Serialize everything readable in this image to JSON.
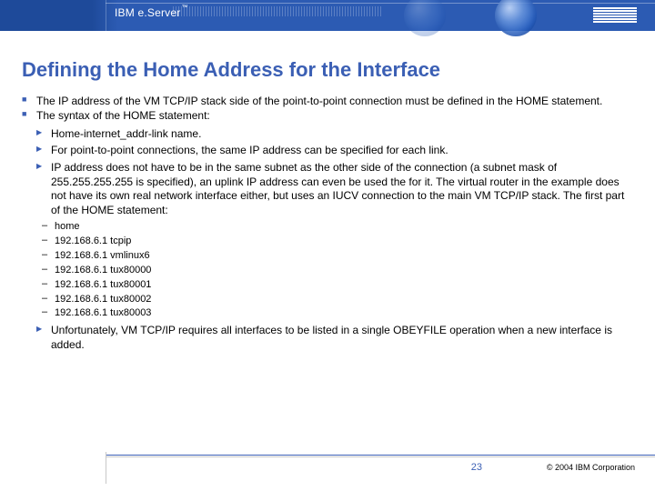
{
  "header": {
    "brand_pre": "IBM e.Server",
    "brand_tm": "™"
  },
  "title": "Defining the Home Address for the Interface",
  "bullets_sq": [
    "The IP address of the VM TCP/IP stack side of the point-to-point connection must be defined in the HOME statement.",
    "The syntax of the HOME statement:"
  ],
  "bullets_tri": [
    "Home-internet_addr-link name.",
    "For point-to-point connections, the same IP address can be specified for each link.",
    "IP address does not have to be in the same subnet as the other side of the connection (a subnet mask of 255.255.255.255 is specified), an uplink IP address can even be used the for it. The virtual router in the example does not have its own real network interface either, but uses an IUCV connection to the main VM TCP/IP stack. The first part of the HOME statement:"
  ],
  "bullets_dash": [
    "home",
    "192.168.6.1 tcpip",
    "192.168.6.1 vmlinux6",
    "192.168.6.1 tux80000",
    "192.168.6.1 tux80001",
    "192.168.6.1 tux80002",
    "192.168.6.1 tux80003"
  ],
  "bullets_tri_tail": [
    "Unfortunately, VM TCP/IP requires all interfaces to be listed in a single OBEYFILE operation when a new interface is added."
  ],
  "footer": {
    "page": "23",
    "copyright": "© 2004 IBM Corporation"
  }
}
